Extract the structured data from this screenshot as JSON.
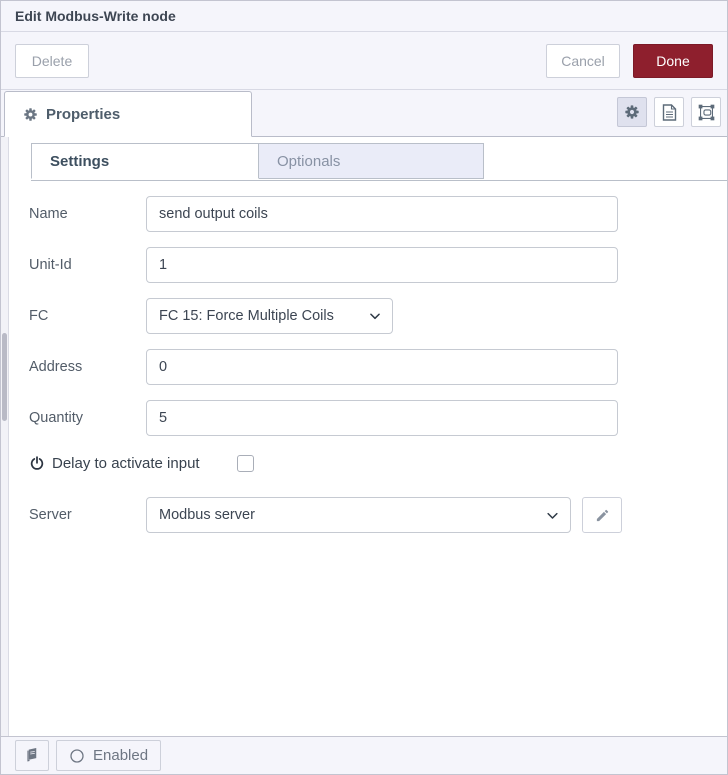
{
  "dialog": {
    "title": "Edit Modbus-Write node"
  },
  "actions": {
    "delete": "Delete",
    "cancel": "Cancel",
    "done": "Done"
  },
  "editor_tabs": {
    "properties": "Properties"
  },
  "icon_buttons": {
    "properties": "gear-icon",
    "description": "document-icon",
    "appearance": "appearance-icon"
  },
  "tabs": {
    "settings": "Settings",
    "optionals": "Optionals"
  },
  "form": {
    "name": {
      "label": "Name",
      "value": "send output coils"
    },
    "unit_id": {
      "label": "Unit-Id",
      "value": "1"
    },
    "fc": {
      "label": "FC",
      "value": "FC 15: Force Multiple Coils"
    },
    "address": {
      "label": "Address",
      "value": "0"
    },
    "quantity": {
      "label": "Quantity",
      "value": "5"
    },
    "delay": {
      "label": "Delay to activate input",
      "checked": false
    },
    "server": {
      "label": "Server",
      "value": "Modbus server"
    }
  },
  "footer": {
    "enabled": "Enabled"
  },
  "colors": {
    "done_bg": "#8e1f2d",
    "chrome_bg": "#f5f5fb",
    "border": "#c3c4d0",
    "icon": "#5d6b79"
  }
}
